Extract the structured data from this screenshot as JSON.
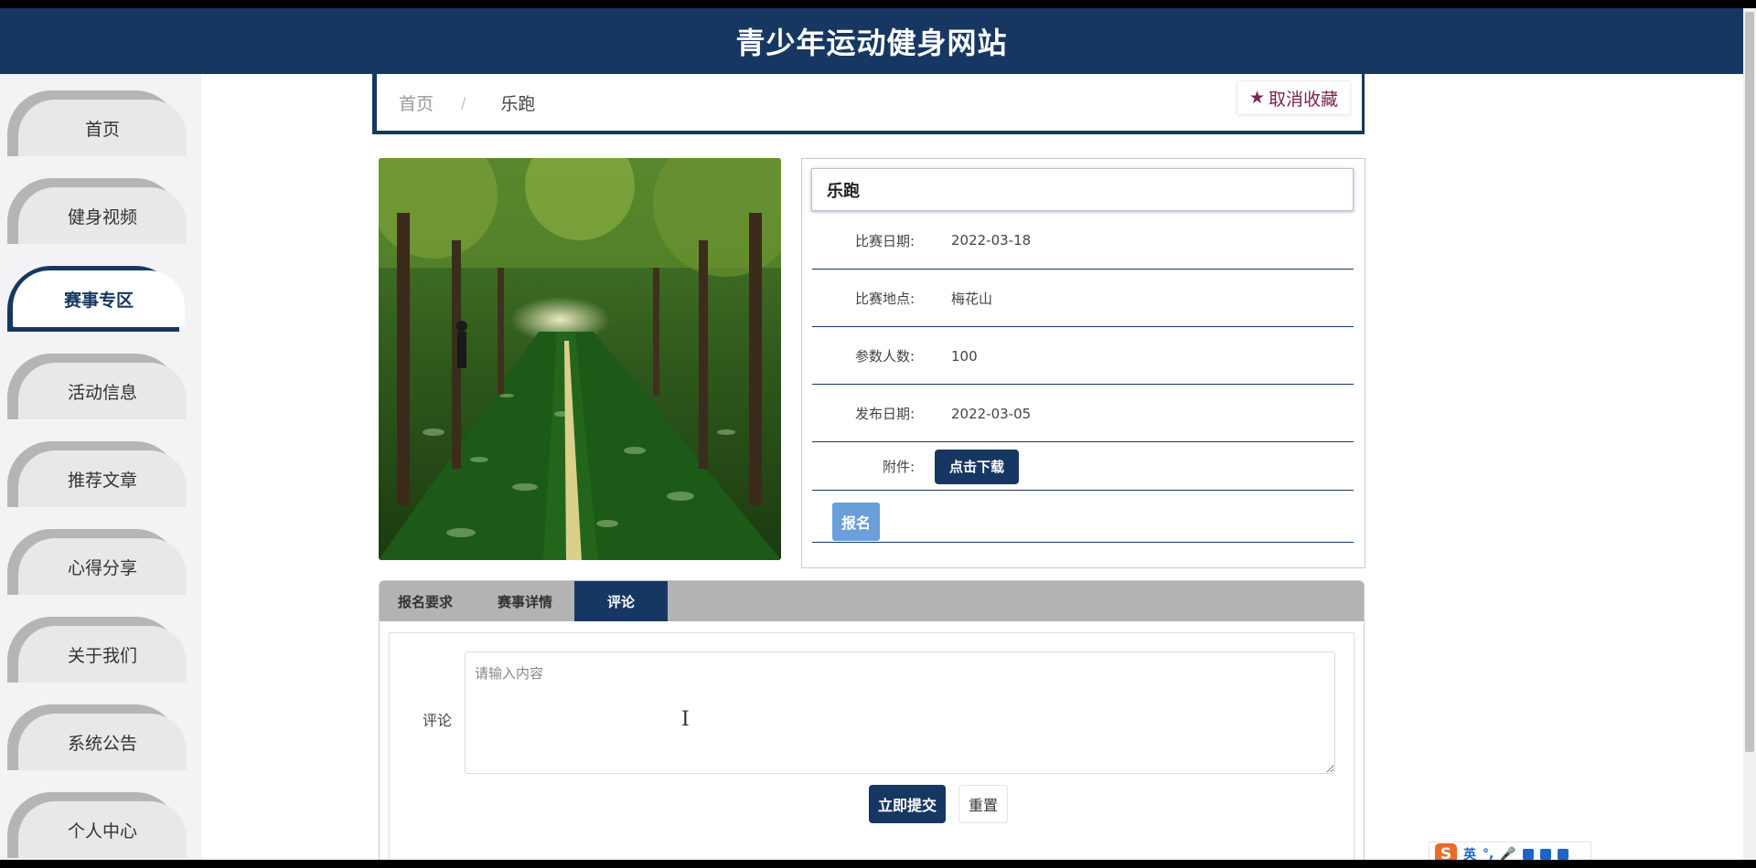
{
  "header": {
    "title": "青少年运动健身网站"
  },
  "sidebar": {
    "items": [
      {
        "label": "首页"
      },
      {
        "label": "健身视频"
      },
      {
        "label": "赛事专区"
      },
      {
        "label": "活动信息"
      },
      {
        "label": "推荐文章"
      },
      {
        "label": "心得分享"
      },
      {
        "label": "关于我们"
      },
      {
        "label": "系统公告"
      },
      {
        "label": "个人中心"
      }
    ],
    "active_index": 2
  },
  "breadcrumb": {
    "home": "首页",
    "separator": "/",
    "current": "乐跑"
  },
  "favorite": {
    "label": "取消收藏",
    "icon": "star-icon"
  },
  "detail": {
    "title": "乐跑",
    "rows": [
      {
        "label": "比赛日期:",
        "value": "2022-03-18"
      },
      {
        "label": "比赛地点:",
        "value": "梅花山"
      },
      {
        "label": "参数人数:",
        "value": "100"
      },
      {
        "label": "发布日期:",
        "value": "2022-03-05"
      }
    ],
    "attachment_label": "附件:",
    "download_label": "点击下载",
    "signup_label": "报名"
  },
  "tabs": [
    {
      "label": "报名要求"
    },
    {
      "label": "赛事详情"
    },
    {
      "label": "评论"
    }
  ],
  "comment_form": {
    "label": "评论",
    "placeholder": "请输入内容",
    "submit_label": "立即提交",
    "reset_label": "重置"
  },
  "ime": {
    "logo": "S",
    "mode": "英",
    "punct": "°,"
  },
  "colors": {
    "primary": "#173763",
    "accent": "#7b2450",
    "signup": "#6a9fd9"
  }
}
